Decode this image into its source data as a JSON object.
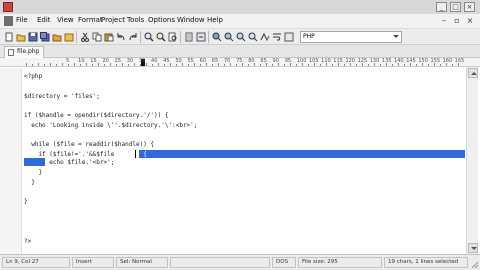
{
  "window": {
    "title": ""
  },
  "menu": {
    "items": [
      "File",
      "Edit",
      "View",
      "Format",
      "Project",
      "Tools",
      "Options",
      "Window",
      "Help"
    ]
  },
  "toolbar": {
    "language": "PHP",
    "icons": [
      "new-file-icon",
      "open-folder-icon",
      "save-icon",
      "save-all-icon",
      "open-project-icon",
      "cut-icon",
      "copy-icon",
      "paste-icon",
      "undo-icon",
      "redo-icon",
      "find-icon",
      "find-replace-icon",
      "find-in-files-icon",
      "document-icon",
      "settings-icon",
      "bookmark-toggle-icon",
      "bookmark-next-icon",
      "bookmark-prev-icon"
    ]
  },
  "tabs": [
    {
      "label": "file.php"
    }
  ],
  "ruler": {
    "labels": [
      "5",
      "10",
      "15",
      "20",
      "25",
      "30",
      "35",
      "40",
      "45",
      "50",
      "55",
      "60",
      "65",
      "70",
      "75",
      "80",
      "85",
      "90",
      "95",
      "100",
      "105",
      "110",
      "115",
      "120",
      "125",
      "130",
      "135",
      "140",
      "145",
      "150",
      "155",
      "160",
      "165",
      "170",
      "175",
      "18"
    ]
  },
  "editor": {
    "lines": [
      "<?php",
      "",
      "$directory = 'files';",
      "",
      "if ($handle = opendir($directory.'/')) {",
      "  echo 'Looking inside \\''.$directory.'\\':<br>';",
      "",
      "  while ($file = readdir($handle)) {",
      "    if ($file!='.'&&$file",
      "       echo $file.'<br>'; ",
      "    }",
      "  }",
      "",
      "}",
      "",
      "",
      "",
      "",
      "",
      "?>"
    ],
    "selected_fragment": "!='..') {"
  },
  "status": {
    "position": "Ln 9, Col 27",
    "insert_mode": "Insert",
    "sel_mode": "Sel: Normal",
    "line_endings": "DOS",
    "file_size": "File size: 295",
    "selection_info": "19 chars, 1 lines selected"
  },
  "colors": {
    "selection": "#2f6bd8"
  }
}
